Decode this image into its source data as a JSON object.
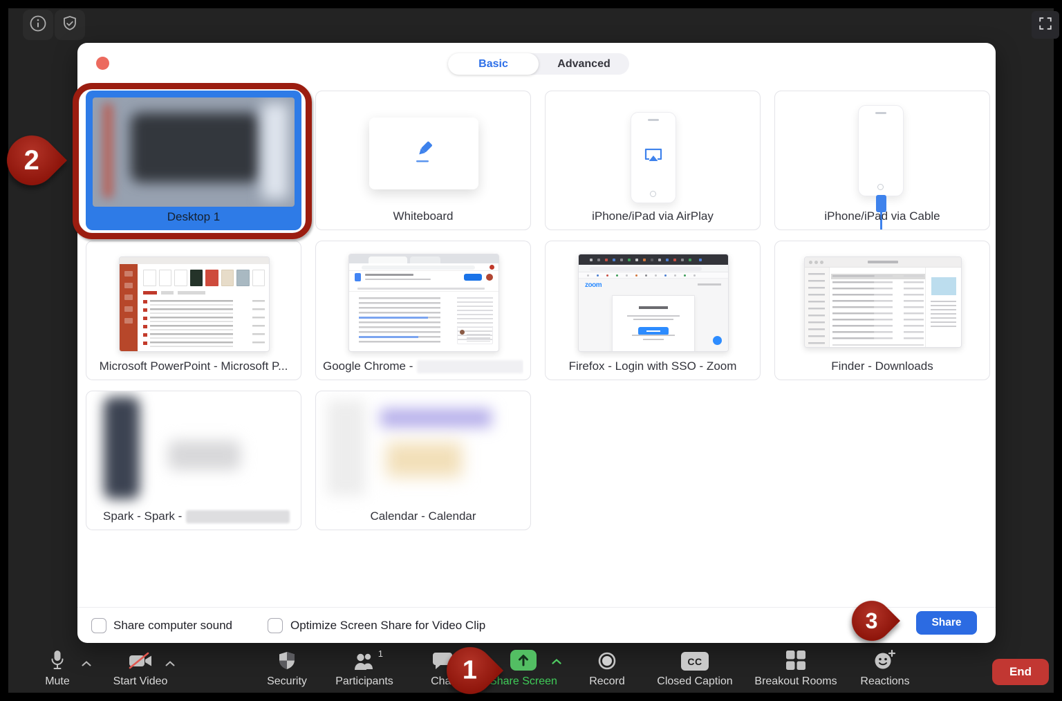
{
  "dialog": {
    "tabs": [
      {
        "label": "Basic",
        "active": true
      },
      {
        "label": "Advanced",
        "active": false
      }
    ],
    "tiles": [
      {
        "label": "Desktop 1",
        "selected": true
      },
      {
        "label": "Whiteboard"
      },
      {
        "label": "iPhone/iPad via AirPlay"
      },
      {
        "label": "iPhone/iPad via Cable"
      },
      {
        "label": "Microsoft PowerPoint - Microsoft P..."
      },
      {
        "label": "Google Chrome -",
        "redacted": true
      },
      {
        "label": "Firefox - Login with SSO - Zoom",
        "thumb_logo": "zoom"
      },
      {
        "label": "Finder - Downloads"
      },
      {
        "label": "Spark - Spark -",
        "redacted": true
      },
      {
        "label": "Calendar - Calendar"
      }
    ],
    "options": [
      {
        "label": "Share computer sound",
        "checked": false
      },
      {
        "label": "Optimize Screen Share for Video Clip",
        "checked": false
      }
    ],
    "share_button_label": "Share"
  },
  "annotations": {
    "step1": "1",
    "step2": "2",
    "step3": "3"
  },
  "toolbar": {
    "items": [
      {
        "label": "Mute",
        "has_chevron": true
      },
      {
        "label": "Start Video",
        "has_chevron": true
      },
      {
        "label": "Security"
      },
      {
        "label": "Participants",
        "badge": "1"
      },
      {
        "label": "Chat"
      },
      {
        "label": "Share Screen",
        "active": true,
        "has_chevron": true
      },
      {
        "label": "Record"
      },
      {
        "label": "Closed Caption",
        "icon_text": "CC"
      },
      {
        "label": "Breakout Rooms"
      },
      {
        "label": "Reactions"
      }
    ],
    "end_button_label": "End"
  },
  "colors": {
    "accent_blue": "#2D6FE8",
    "selected_tile_blue": "#2E7BE7",
    "share_green": "#53BE63",
    "annotation_red": "#9B1D10",
    "end_red": "#C23732",
    "close_dot": "#EC6A5E"
  }
}
